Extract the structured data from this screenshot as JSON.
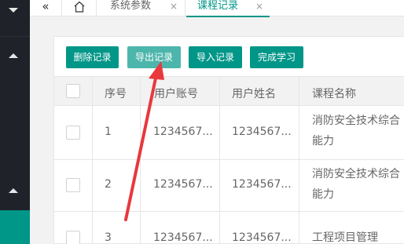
{
  "sidebar": {
    "accent": "#009688"
  },
  "tabs": {
    "collapse_glyph": "«",
    "params": {
      "label": "系统参数",
      "close": "×"
    },
    "records": {
      "label": "课程记录",
      "close": "×"
    }
  },
  "toolbar": {
    "delete_label": "删除记录",
    "export_label": "导出记录",
    "import_label": "导入记录",
    "finish_label": "完成学习"
  },
  "table": {
    "headers": {
      "index": "序号",
      "account": "用户账号",
      "name": "用户姓名",
      "course": "课程名称"
    },
    "rows": [
      {
        "index": "1",
        "account": "1234567...",
        "name": "1234567...",
        "course": "消防安全技术综合能力"
      },
      {
        "index": "2",
        "account": "1234567...",
        "name": "1234567...",
        "course": "消防安全技术综合能力"
      },
      {
        "index": "3",
        "account": "1234567...",
        "name": "1234567...",
        "course": "工程项目管理"
      }
    ]
  },
  "annotation": {
    "color": "#e8383d"
  }
}
